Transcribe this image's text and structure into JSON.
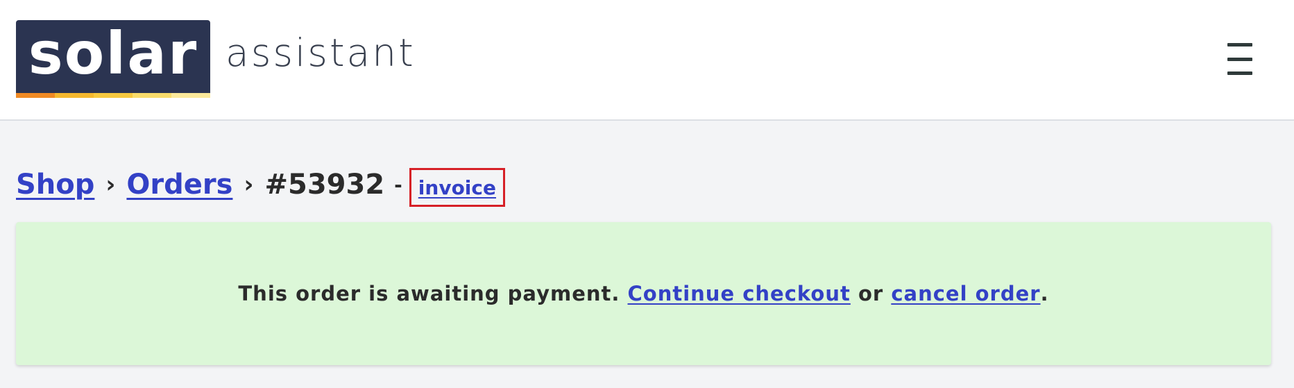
{
  "logo": {
    "brand": "solar",
    "tagline": "assistant",
    "colors": {
      "box": "#2b3451",
      "stripe": [
        "#f08a24",
        "#f5b82e",
        "#f7c93f",
        "#f9dc6b",
        "#fbe99a"
      ]
    }
  },
  "header": {
    "menu_icon": "hamburger-menu-icon"
  },
  "breadcrumb": {
    "shop": "Shop",
    "separator": "›",
    "orders": "Orders",
    "order_number": "#53932",
    "dash": "-",
    "invoice": "invoice"
  },
  "notice": {
    "text_before": "This order is awaiting payment.",
    "continue_link": "Continue checkout",
    "or_text": "or",
    "cancel_link": "cancel order",
    "text_after": "."
  },
  "colors": {
    "link": "#3341c6",
    "notice_background": "#dcf7d8",
    "highlight_border": "#d62027"
  }
}
